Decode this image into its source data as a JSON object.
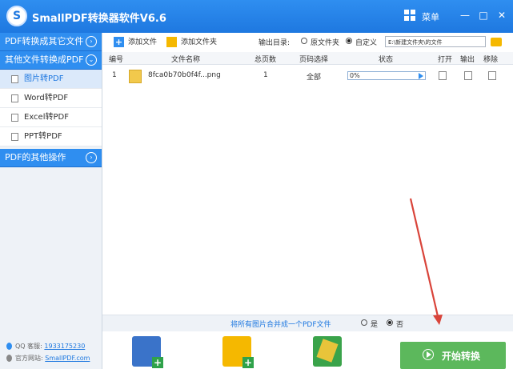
{
  "app": {
    "title": "SmallPDF转换器软件V6.6",
    "logo_letter": "S",
    "menu_label": "菜单"
  },
  "window_controls": {
    "minimize": "—",
    "maximize": "□",
    "close": "✕"
  },
  "sidebar": {
    "section1": "PDF转换成其它文件",
    "section2": "其他文件转换成PDF",
    "items": [
      {
        "label": "图片转PDF",
        "active": true
      },
      {
        "label": "Word转PDF",
        "active": false
      },
      {
        "label": "Excel转PDF",
        "active": false
      },
      {
        "label": "PPT转PDF",
        "active": false
      }
    ],
    "section3": "PDF的其他操作",
    "footer": {
      "qq_label": "QQ 客服:",
      "qq_number": "1933175230",
      "site_label": "官方网站:",
      "site_url": "SmallPDF.com"
    }
  },
  "toolbar": {
    "add_file": "添加文件",
    "add_folder": "添加文件夹",
    "output_label": "输出目录:",
    "option_original": "原文件夹",
    "option_custom": "自定义",
    "output_path": "E:\\新建文件夹\\的文件"
  },
  "table": {
    "headers": [
      "编号",
      "文件名称",
      "总页数",
      "页码选择",
      "状态",
      "打开",
      "输出",
      "移除"
    ],
    "rows": [
      {
        "index": "1",
        "filename": "8fca0b70b0f4f...png",
        "pages": "1",
        "page_range": "全部",
        "progress": "0%"
      }
    ]
  },
  "merge": {
    "text": "将所有图片合并成一个PDF文件",
    "yes": "是",
    "no": "否",
    "selected": "no"
  },
  "start_button": "开始转换",
  "colors": {
    "brand": "#2f8ef0",
    "start": "#5cb85c",
    "annotation_arrow": "#d9443a"
  }
}
